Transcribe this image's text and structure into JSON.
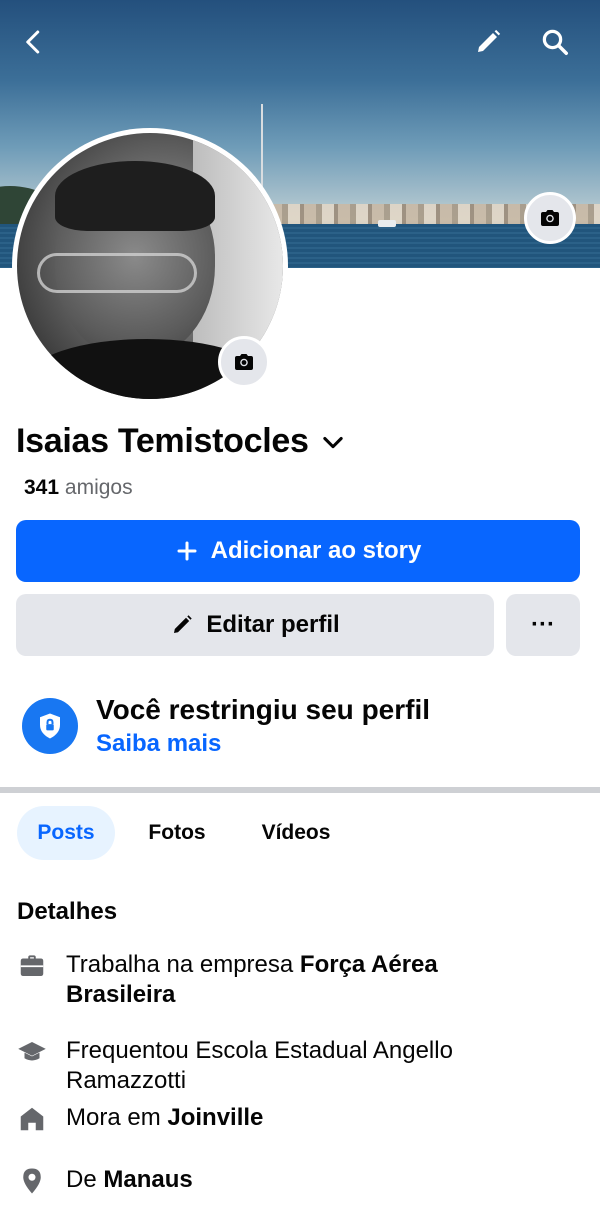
{
  "header": {
    "back_icon": "chevron-left-icon",
    "edit_icon": "pencil-icon",
    "search_icon": "search-icon"
  },
  "profile": {
    "name": "Isaias Temistocles",
    "friends_count": "341",
    "friends_label": "amigos"
  },
  "actions": {
    "add_story_label": "Adicionar ao story",
    "edit_profile_label": "Editar perfil",
    "more_label": "···"
  },
  "restricted": {
    "title": "Você restringiu seu perfil",
    "link": "Saiba mais"
  },
  "tabs": [
    {
      "label": "Posts",
      "active": true
    },
    {
      "label": "Fotos",
      "active": false
    },
    {
      "label": "Vídeos",
      "active": false
    }
  ],
  "details": {
    "title": "Detalhes",
    "items": [
      {
        "icon": "briefcase-icon",
        "prefix": "Trabalha na empresa ",
        "bold": "Força Aérea Brasileira"
      },
      {
        "icon": "graduation-cap-icon",
        "prefix": "Frequentou Escola Estadual Angello Ramazzotti",
        "bold": ""
      },
      {
        "icon": "house-icon",
        "prefix": "Mora em ",
        "bold": "Joinville"
      },
      {
        "icon": "location-pin-icon",
        "prefix": "De ",
        "bold": "Manaus"
      }
    ]
  },
  "colors": {
    "primary": "#0866ff",
    "secondary_bg": "#e4e6eb",
    "muted_text": "#65676b",
    "active_tab_bg": "#e7f3ff"
  }
}
